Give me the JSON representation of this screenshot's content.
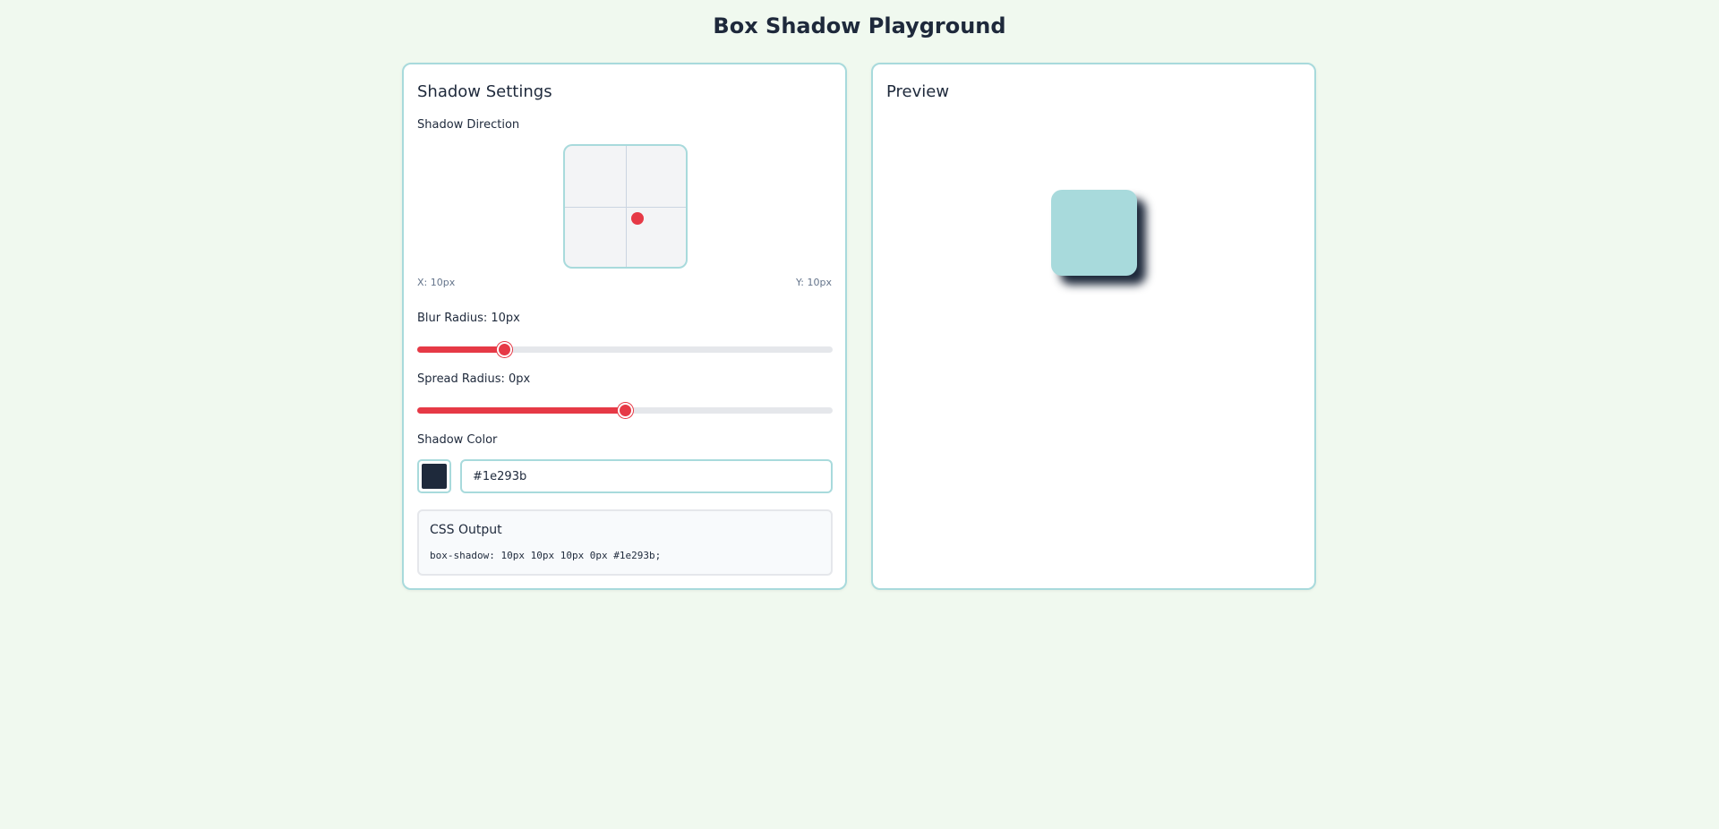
{
  "page": {
    "title": "Box Shadow Playground"
  },
  "settings": {
    "heading": "Shadow Settings",
    "direction": {
      "label": "Shadow Direction",
      "x_label": "X: 10px",
      "y_label": "Y: 10px"
    },
    "blur": {
      "label": "Blur Radius: 10px",
      "value": 10,
      "fraction": 0.21
    },
    "spread": {
      "label": "Spread Radius: 0px",
      "value": 0,
      "fraction": 0.5
    },
    "color": {
      "label": "Shadow Color",
      "value": "#1e293b"
    },
    "css_output": {
      "title": "CSS Output",
      "code": "box-shadow: 10px 10px 10px 0px #1e293b;"
    }
  },
  "preview": {
    "heading": "Preview",
    "box_color": "#a8dadc"
  },
  "colors": {
    "accent": "#e63946",
    "border": "#a8dadc",
    "background": "#f0f9ef",
    "text": "#1e293b"
  }
}
